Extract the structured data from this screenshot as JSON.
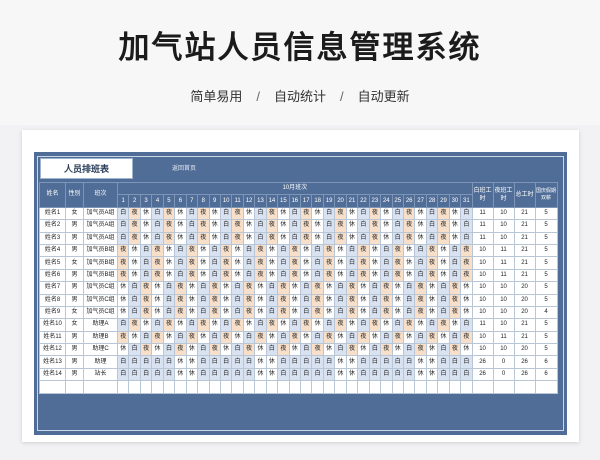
{
  "page": {
    "title": "加气站人员信息管理系统",
    "tags": [
      "简单易用",
      "自动统计",
      "自动更新"
    ],
    "separator": "/"
  },
  "sheet": {
    "tab_label": "人员排班表",
    "back_link": "返回首页",
    "month_header": "10月班次",
    "columns": {
      "name": "姓名",
      "gender": "性别",
      "shift_group": "班次",
      "day_count": "白班工时",
      "night_count": "夜班工时",
      "total": "总工时",
      "rest": "国庆假期双薪"
    },
    "days": [
      "1",
      "2",
      "3",
      "4",
      "5",
      "6",
      "7",
      "8",
      "9",
      "10",
      "11",
      "12",
      "13",
      "14",
      "15",
      "16",
      "17",
      "18",
      "19",
      "20",
      "21",
      "22",
      "23",
      "24",
      "25",
      "26",
      "27",
      "28",
      "29",
      "30",
      "31"
    ],
    "rows": [
      {
        "name": "姓名1",
        "gender": "女",
        "group": "加气员A组",
        "pattern": "白夜休白夜休白夜休白夜休白夜休白夜休白夜休白夜休白夜休白夜休白",
        "day": "11",
        "night": "10",
        "total": "21",
        "rest": "5"
      },
      {
        "name": "姓名2",
        "gender": "男",
        "group": "加气员A组",
        "pattern": "白夜休白夜休白夜休白夜休白夜休白夜休白夜休白夜休白夜休白夜休白",
        "day": "11",
        "night": "10",
        "total": "21",
        "rest": "5"
      },
      {
        "name": "姓名3",
        "gender": "男",
        "group": "加气员A组",
        "pattern": "白夜休白夜休白夜休白夜休白夜休白夜休白夜休白夜休白夜休白夜休白",
        "day": "11",
        "night": "10",
        "total": "21",
        "rest": "5"
      },
      {
        "name": "姓名4",
        "gender": "男",
        "group": "加气员B组",
        "pattern": "夜休白夜休白夜休白夜休白夜休白夜休白夜休白夜休白夜休白夜休白夜",
        "day": "10",
        "night": "11",
        "total": "21",
        "rest": "5"
      },
      {
        "name": "姓名5",
        "gender": "女",
        "group": "加气员B组",
        "pattern": "夜休白夜休白夜休白夜休白夜休白夜休白夜休白夜休白夜休白夜休白夜",
        "day": "10",
        "night": "11",
        "total": "21",
        "rest": "5"
      },
      {
        "name": "姓名6",
        "gender": "男",
        "group": "加气员B组",
        "pattern": "夜休白夜休白夜休白夜休白夜休白夜休白夜休白夜休白夜休白夜休白夜",
        "day": "10",
        "night": "11",
        "total": "21",
        "rest": "5"
      },
      {
        "name": "姓名7",
        "gender": "男",
        "group": "加气员C组",
        "pattern": "休白夜休白夜休白夜休白夜休白夜休白夜休白夜休白夜休白夜休白夜休",
        "day": "10",
        "night": "10",
        "total": "20",
        "rest": "5"
      },
      {
        "name": "姓名8",
        "gender": "男",
        "group": "加气员C组",
        "pattern": "休白夜休白夜休白夜休白夜休白夜休白夜休白夜休白夜休白夜休白夜休",
        "day": "10",
        "night": "10",
        "total": "20",
        "rest": "5"
      },
      {
        "name": "姓名9",
        "gender": "女",
        "group": "加气员C组",
        "pattern": "休白夜休白夜休白夜休白夜休白夜休白夜休白夜休白夜休白夜休白夜休",
        "day": "10",
        "night": "10",
        "total": "20",
        "rest": "4"
      },
      {
        "name": "姓名10",
        "gender": "女",
        "group": "助理A",
        "pattern": "白夜休白夜休白夜休白夜休白夜休白夜休白夜休白夜休白夜休白夜休白",
        "day": "11",
        "night": "10",
        "total": "21",
        "rest": "5"
      },
      {
        "name": "姓名11",
        "gender": "男",
        "group": "助理B",
        "pattern": "夜休白夜休白夜休白夜休白夜休白夜休白夜休白夜休白夜休白夜休白夜",
        "day": "10",
        "night": "11",
        "total": "21",
        "rest": "5"
      },
      {
        "name": "姓名12",
        "gender": "男",
        "group": "助理C",
        "pattern": "休白夜休白夜休白夜休白夜休白夜休白夜休白夜休白夜休白夜休白夜休",
        "day": "10",
        "night": "10",
        "total": "20",
        "rest": "5"
      },
      {
        "name": "姓名13",
        "gender": "男",
        "group": "助理",
        "pattern": "白白白白白休休白白白白白休休白白白白白休休白白白白白休休白白白",
        "day": "26",
        "night": "0",
        "total": "26",
        "rest": "6"
      },
      {
        "name": "姓名14",
        "gender": "男",
        "group": "站长",
        "pattern": "白白白白白休休白白白白白休休白白白白白休休白白白白白休休白白白",
        "day": "26",
        "night": "0",
        "total": "26",
        "rest": "6"
      }
    ]
  }
}
